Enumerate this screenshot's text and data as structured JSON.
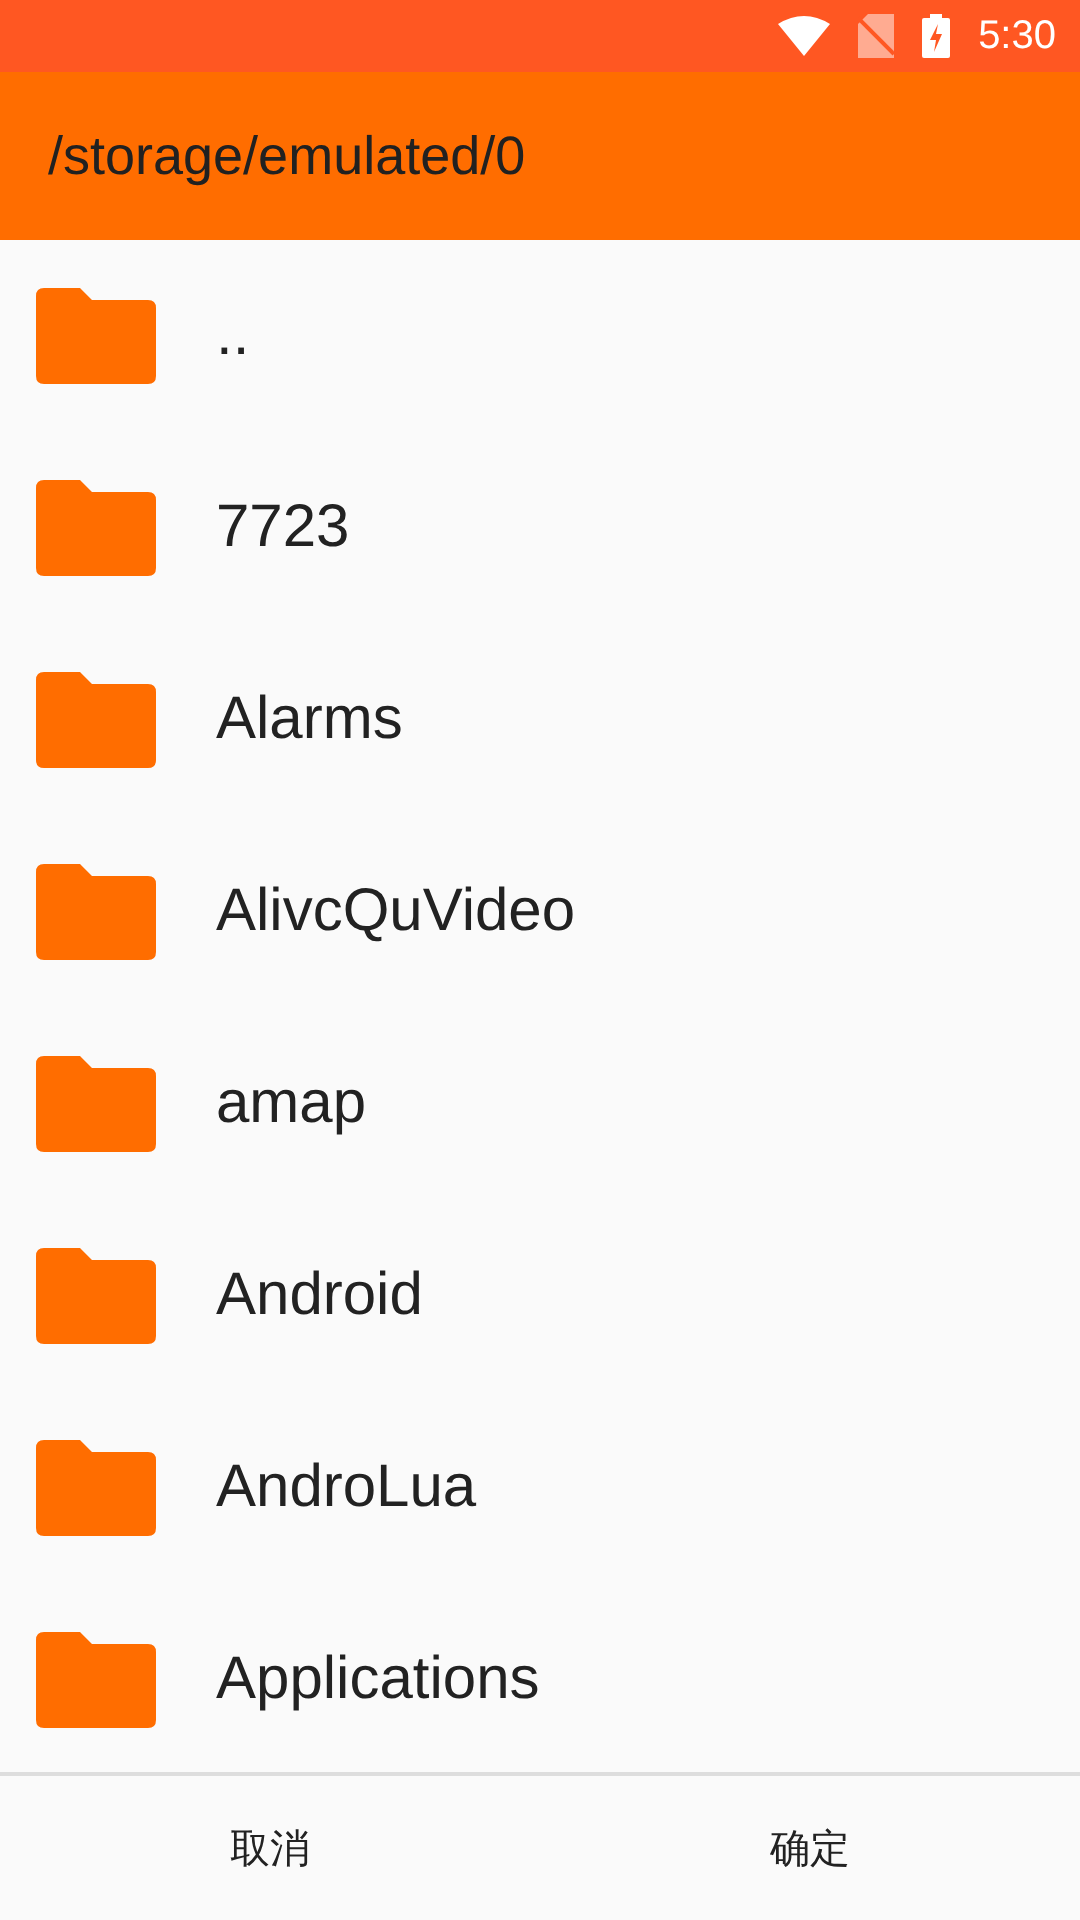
{
  "status_bar": {
    "time": "5:30"
  },
  "app_bar": {
    "title": "/storage/emulated/0"
  },
  "folders": [
    {
      "name": ".."
    },
    {
      "name": "7723"
    },
    {
      "name": "Alarms"
    },
    {
      "name": "AlivcQuVideo"
    },
    {
      "name": "amap"
    },
    {
      "name": "Android"
    },
    {
      "name": "AndroLua"
    },
    {
      "name": "Applications"
    }
  ],
  "buttons": [
    {
      "label": "取消"
    },
    {
      "label": "确定"
    }
  ]
}
